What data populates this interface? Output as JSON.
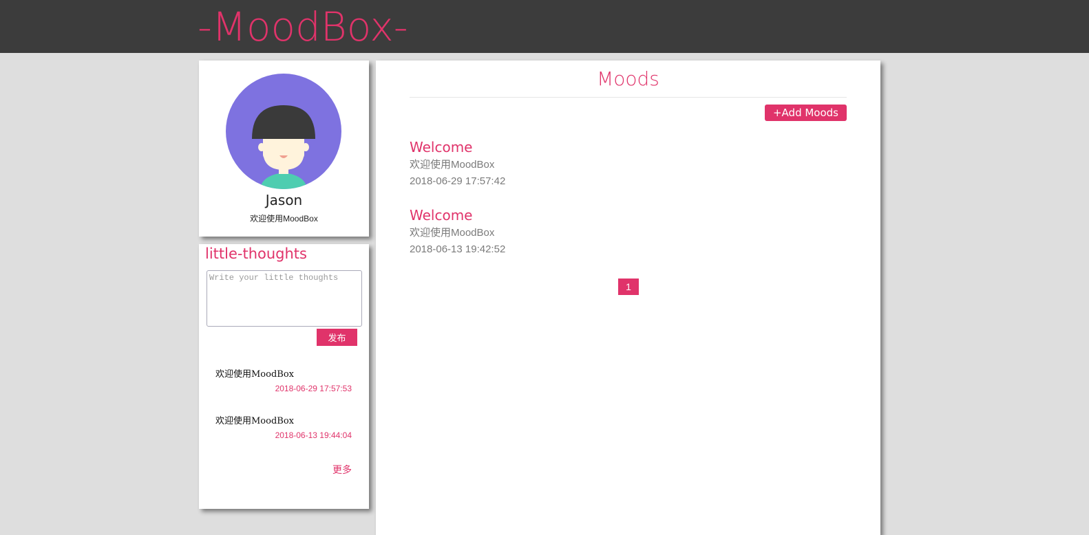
{
  "header": {
    "logo": "-MoodBox-"
  },
  "profile": {
    "name": "Jason",
    "description": "欢迎使用MoodBox",
    "avatar_colors": {
      "background": "#7e72e0",
      "hair": "#3a3a3a",
      "skin": "#fff3dc",
      "shirt": "#4ecdb0",
      "mouth": "#f0a090"
    }
  },
  "thoughts": {
    "title": "little-thoughts",
    "placeholder": "Write your little thoughts",
    "value": "",
    "publish_label": "发布",
    "items": [
      {
        "text": "欢迎使用MoodBox",
        "time": "2018-06-29 17:57:53"
      },
      {
        "text": "欢迎使用MoodBox",
        "time": "2018-06-13 19:44:04"
      }
    ],
    "more_label": "更多"
  },
  "main": {
    "title": "Moods",
    "add_label": "+Add Moods",
    "moods": [
      {
        "title": "Welcome",
        "content": "欢迎使用MoodBox",
        "time": "2018-06-29 17:57:42"
      },
      {
        "title": "Welcome",
        "content": "欢迎使用MoodBox",
        "time": "2018-06-13 19:42:52"
      }
    ],
    "pagination": {
      "current": "1"
    }
  },
  "colors": {
    "accent": "#e0336a",
    "topbar": "#3c3c3c",
    "background": "#dedede"
  }
}
